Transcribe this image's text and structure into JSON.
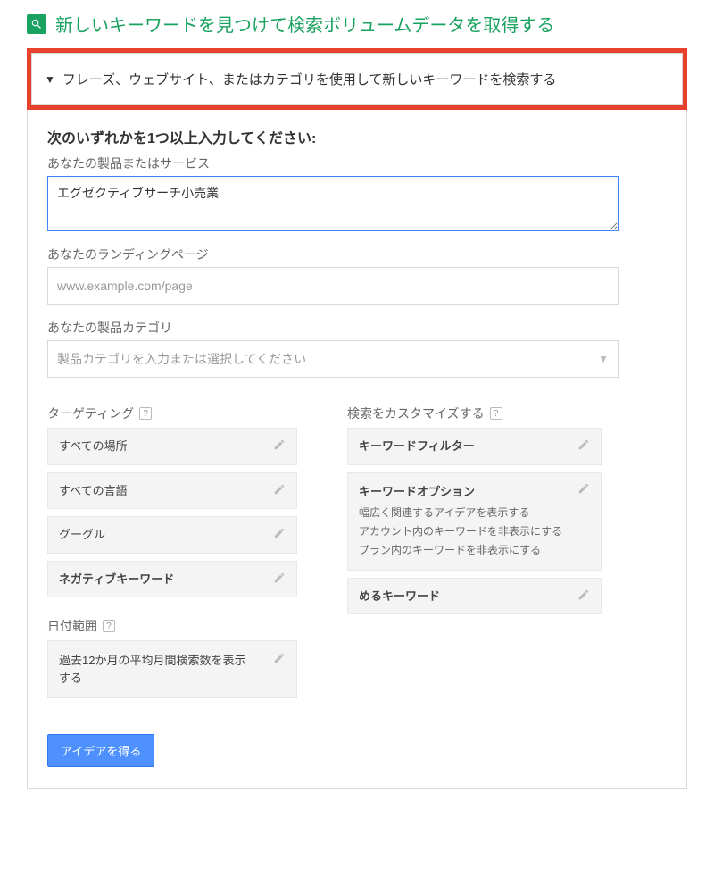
{
  "page_title": "新しいキーワードを見つけて検索ボリュームデータを取得する",
  "expand_header": "フレーズ、ウェブサイト、またはカテゴリを使用して新しいキーワードを検索する",
  "instruction": "次のいずれかを1つ以上入力してください:",
  "fields": {
    "product_label": "あなたの製品またはサービス",
    "product_value": "エグゼクティブサーチ小売業",
    "landing_label": "あなたのランディングページ",
    "landing_placeholder": "www.example.com/page",
    "category_label": "あなたの製品カテゴリ",
    "category_placeholder": "製品カテゴリを入力または選択してください"
  },
  "targeting": {
    "header": "ターゲティング",
    "items": {
      "locations": "すべての場所",
      "languages": "すべての言語",
      "networks": "グーグル",
      "negative": "ネガティブキーワード"
    }
  },
  "date_range": {
    "header": "日付範囲",
    "text": "過去12か月の平均月間検索数を表示する"
  },
  "customize": {
    "header": "検索をカスタマイズする",
    "filter_label": "キーワードフィルター",
    "options": {
      "title": "キーワードオプション",
      "line1": "幅広く関連するアイデアを表示する",
      "line2": "アカウント内のキーワードを非表示にする",
      "line3": "プラン内のキーワードを非表示にする"
    },
    "include": "めるキーワード"
  },
  "submit_label": "アイデアを得る"
}
